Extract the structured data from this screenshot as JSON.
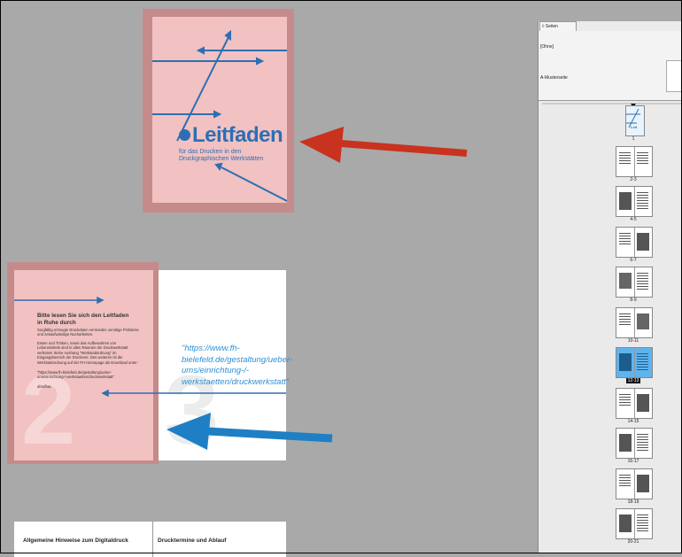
{
  "cover": {
    "title": "Leitfaden",
    "subtitle": "für das Drucken in den Druckgraphischen Werkstätten"
  },
  "page2": {
    "number": "2",
    "heading": "Bitte lesen Sie sich den Leitfaden in Ruhe durch",
    "para1": "Sorgfältig  erzeugte Druckdaten vermeiden unnötige Probleme und zeitaufwändige Nacharbeiten.",
    "para2": "Essen und Trinken, sowie das Aufbewahren von Lebensmitteln sind in allen Räumen der Druckwerkstatt verboten! Siehe Aushang \"Werkstattordnung\" im Eingangsbereich der Druckerei. Des weiteren ist die Werkstattordnung auf der FH Homepage als Download unter:",
    "url": "\"https://www.fh-bielefeld.de/gestaltung/ueber-ums/einrichtung-/-werkstaetten/druckwerkstatt\"",
    "closing": "abrufbar."
  },
  "page3": {
    "number": "3",
    "quote": "\"https://www.fh-bielefeld.de/gestaltung/ueber-ums/einrichtung-/-werkstaetten/druckwerkstatt\""
  },
  "page4": {
    "heading": "Allgemeine Hinweise zum Digitaldruck"
  },
  "page5": {
    "heading": "Drucktermine und Ablauf"
  },
  "pages_panel": {
    "tab_label": "◊ Seiten",
    "none_label": "[Ohne]",
    "master_label": "A-Musterseite",
    "entries": [
      {
        "label": "1"
      },
      {
        "label": "2-3"
      },
      {
        "label": "4-5"
      },
      {
        "label": "6-7"
      },
      {
        "label": "8-9"
      },
      {
        "label": "10-11"
      },
      {
        "label": "12-13",
        "selected": true
      },
      {
        "label": "14-15"
      },
      {
        "label": "16-17"
      },
      {
        "label": "18-19"
      },
      {
        "label": "20-21"
      }
    ]
  },
  "colors": {
    "pasteboard": "#a9a9a9",
    "page_pink": "#f2c1c1",
    "bleed": "#c58b8b",
    "brand_blue": "#2d6fb3",
    "arrow_red": "#c8321f",
    "arrow_blue": "#1f7fc4"
  }
}
